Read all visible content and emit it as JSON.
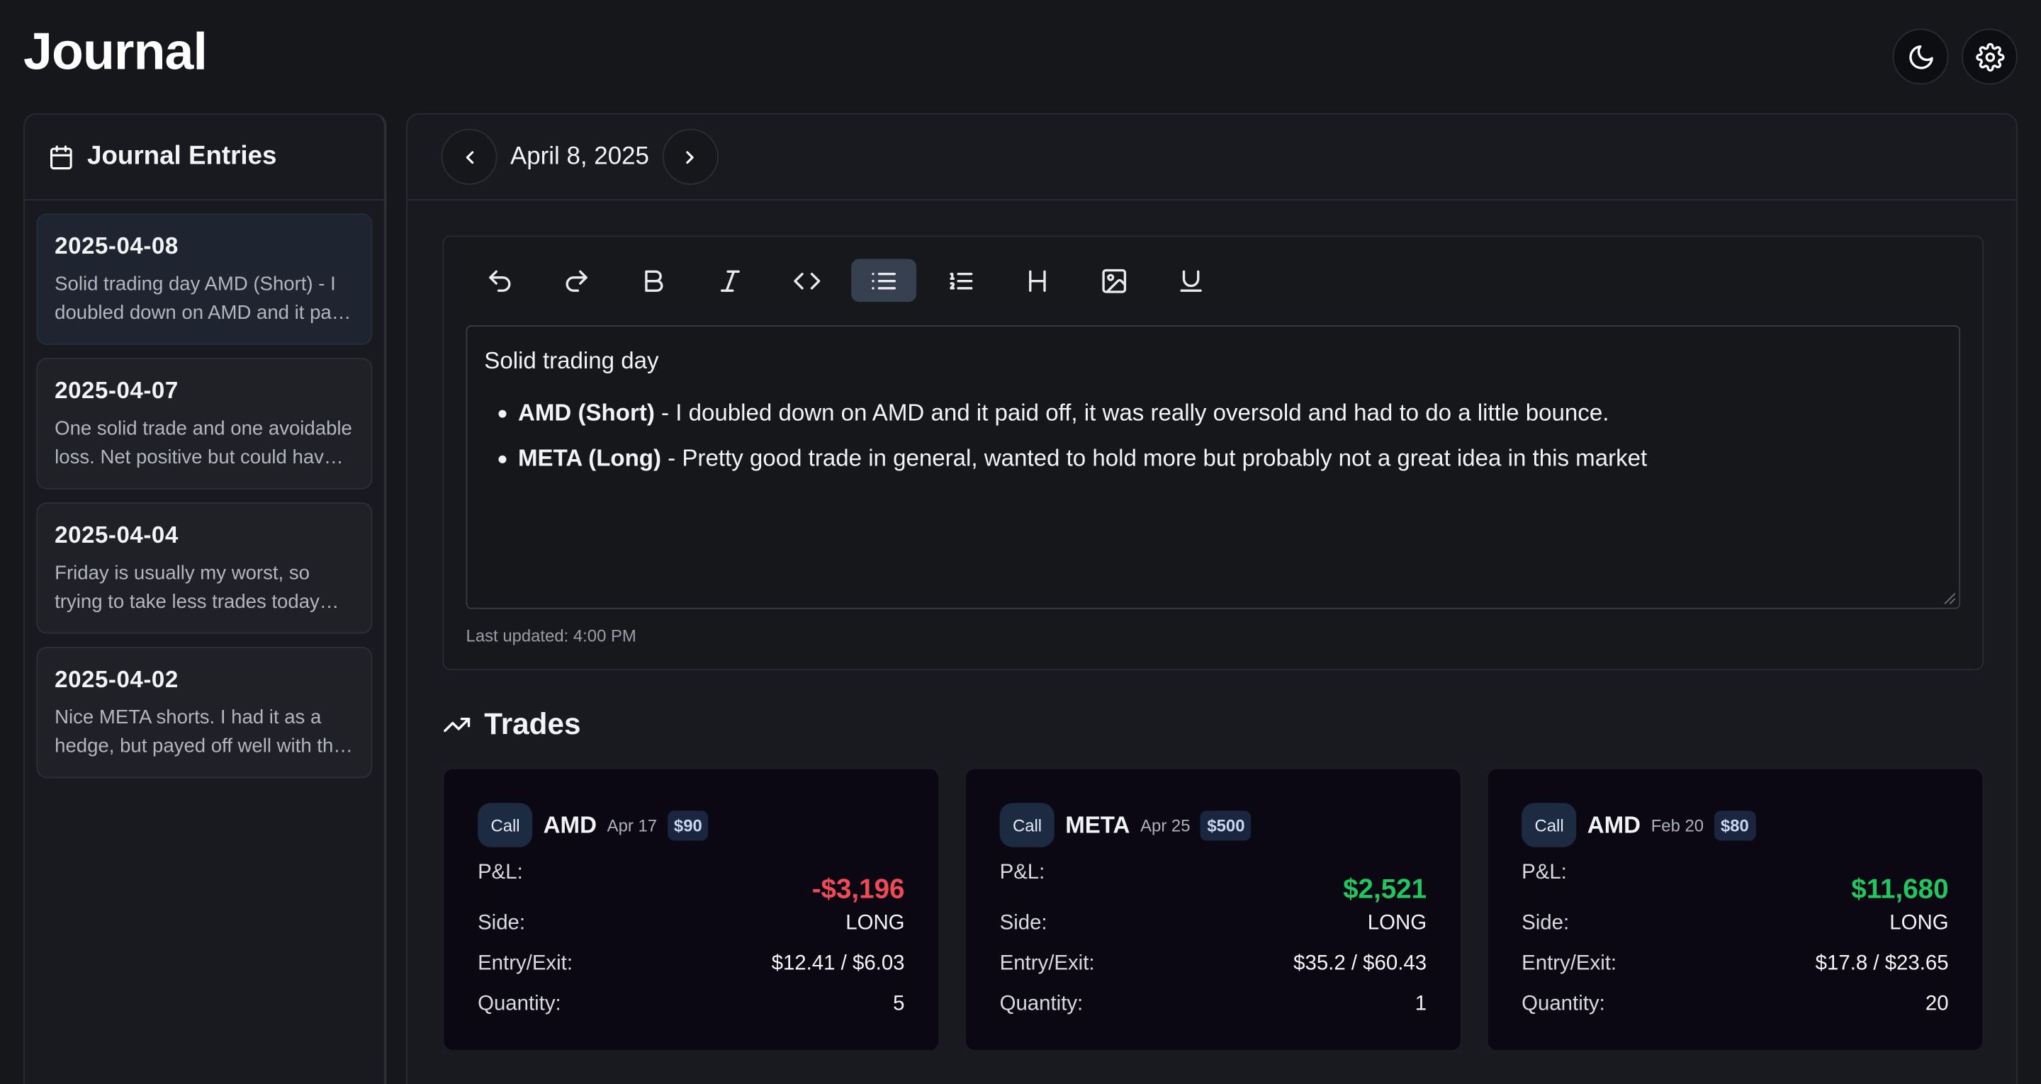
{
  "app": {
    "title": "Journal"
  },
  "sidebar": {
    "title": "Journal Entries",
    "entries": [
      {
        "date": "2025-04-08",
        "preview": "Solid trading day AMD (Short) - I doubled down on AMD and it paid off, it was really oversold"
      },
      {
        "date": "2025-04-07",
        "preview": "One solid trade and one avoidable loss. Net positive but could have been better"
      },
      {
        "date": "2025-04-04",
        "preview": "Friday is usually my worst, so trying to take less trades today and focus"
      },
      {
        "date": "2025-04-02",
        "preview": "Nice META shorts. I had it as a hedge, but payed off well with the market drop"
      }
    ]
  },
  "main": {
    "date": "April 8, 2025",
    "editor": {
      "heading": "Solid trading day",
      "bullets": [
        {
          "bold": "AMD (Short)",
          "text": " - I doubled down on AMD and it paid off, it was really oversold and had to do a little bounce."
        },
        {
          "bold": "META (Long)",
          "text": " - Pretty good trade in general, wanted to hold more but probably not a great idea in this market"
        }
      ],
      "last_updated": "Last updated: 4:00 PM"
    },
    "trades_title": "Trades",
    "trade_labels": {
      "pl": "P&L:",
      "side": "Side:",
      "entry_exit": "Entry/Exit:",
      "quantity": "Quantity:"
    },
    "trades": [
      {
        "type": "Call",
        "ticker": "AMD",
        "expiry": "Apr 17",
        "strike": "$90",
        "pl": "-$3,196",
        "side": "LONG",
        "entry_exit": "$12.41 / $6.03",
        "quantity": "5"
      },
      {
        "type": "Call",
        "ticker": "META",
        "expiry": "Apr 25",
        "strike": "$500",
        "pl": "$2,521",
        "side": "LONG",
        "entry_exit": "$35.2 / $60.43",
        "quantity": "1"
      },
      {
        "type": "Call",
        "ticker": "AMD",
        "expiry": "Feb 20",
        "strike": "$80",
        "pl": "$11,680",
        "side": "LONG",
        "entry_exit": "$17.8 / $23.65",
        "quantity": "20"
      }
    ]
  },
  "icons": {
    "theme": "moon-icon",
    "settings": "gear-icon",
    "calendar": "calendar-icon",
    "prev": "chevron-left-icon",
    "next": "chevron-right-icon",
    "trending": "trending-up-icon"
  },
  "colors": {
    "negative": "#ef4a57",
    "positive": "#22c55e",
    "active_tool": "#37404f"
  }
}
